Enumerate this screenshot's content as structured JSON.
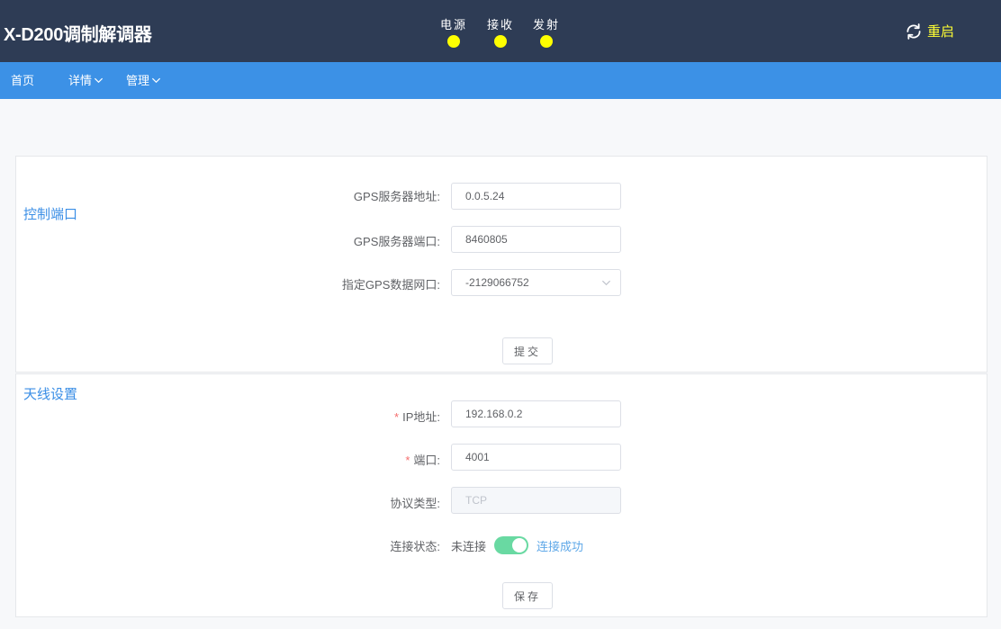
{
  "header": {
    "title": "X-D200调制解调器",
    "indicators": [
      {
        "label": "电源",
        "color": "#ffff00"
      },
      {
        "label": "接收",
        "color": "#ffff00"
      },
      {
        "label": "发射",
        "color": "#ffff00"
      }
    ],
    "restart_label": "重启",
    "restart_color": "#ffff33"
  },
  "nav": {
    "items": [
      {
        "label": "首页",
        "has_dropdown": false
      },
      {
        "label": "详情",
        "has_dropdown": true
      },
      {
        "label": "管理",
        "has_dropdown": true
      }
    ]
  },
  "control_port": {
    "title": "控制端口",
    "gps_server_address": {
      "label": "GPS服务器地址:",
      "value": "0.0.5.24"
    },
    "gps_server_port": {
      "label": "GPS服务器端口:",
      "value": "8460805"
    },
    "gps_data_port": {
      "label": "指定GPS数据网口:",
      "value": "-2129066752"
    },
    "submit_label": "提交"
  },
  "antenna": {
    "title": "天线设置",
    "ip": {
      "label": "IP地址:",
      "required_mark": "*",
      "value": "192.168.0.2"
    },
    "port": {
      "label": "端口:",
      "required_mark": "*",
      "value": "4001"
    },
    "protocol": {
      "label": "协议类型:",
      "value": "TCP"
    },
    "status": {
      "label": "连接状态:",
      "off_label": "未连接",
      "on_label": "连接成功",
      "checked": true
    },
    "save_label": "保存"
  },
  "colors": {
    "header_bg": "#2e3c55",
    "nav_bg": "#3c91e6",
    "section_title": "#3a8ee6",
    "switch_on": "#69d9a2",
    "switch_on_label": "#5fa8e8"
  }
}
